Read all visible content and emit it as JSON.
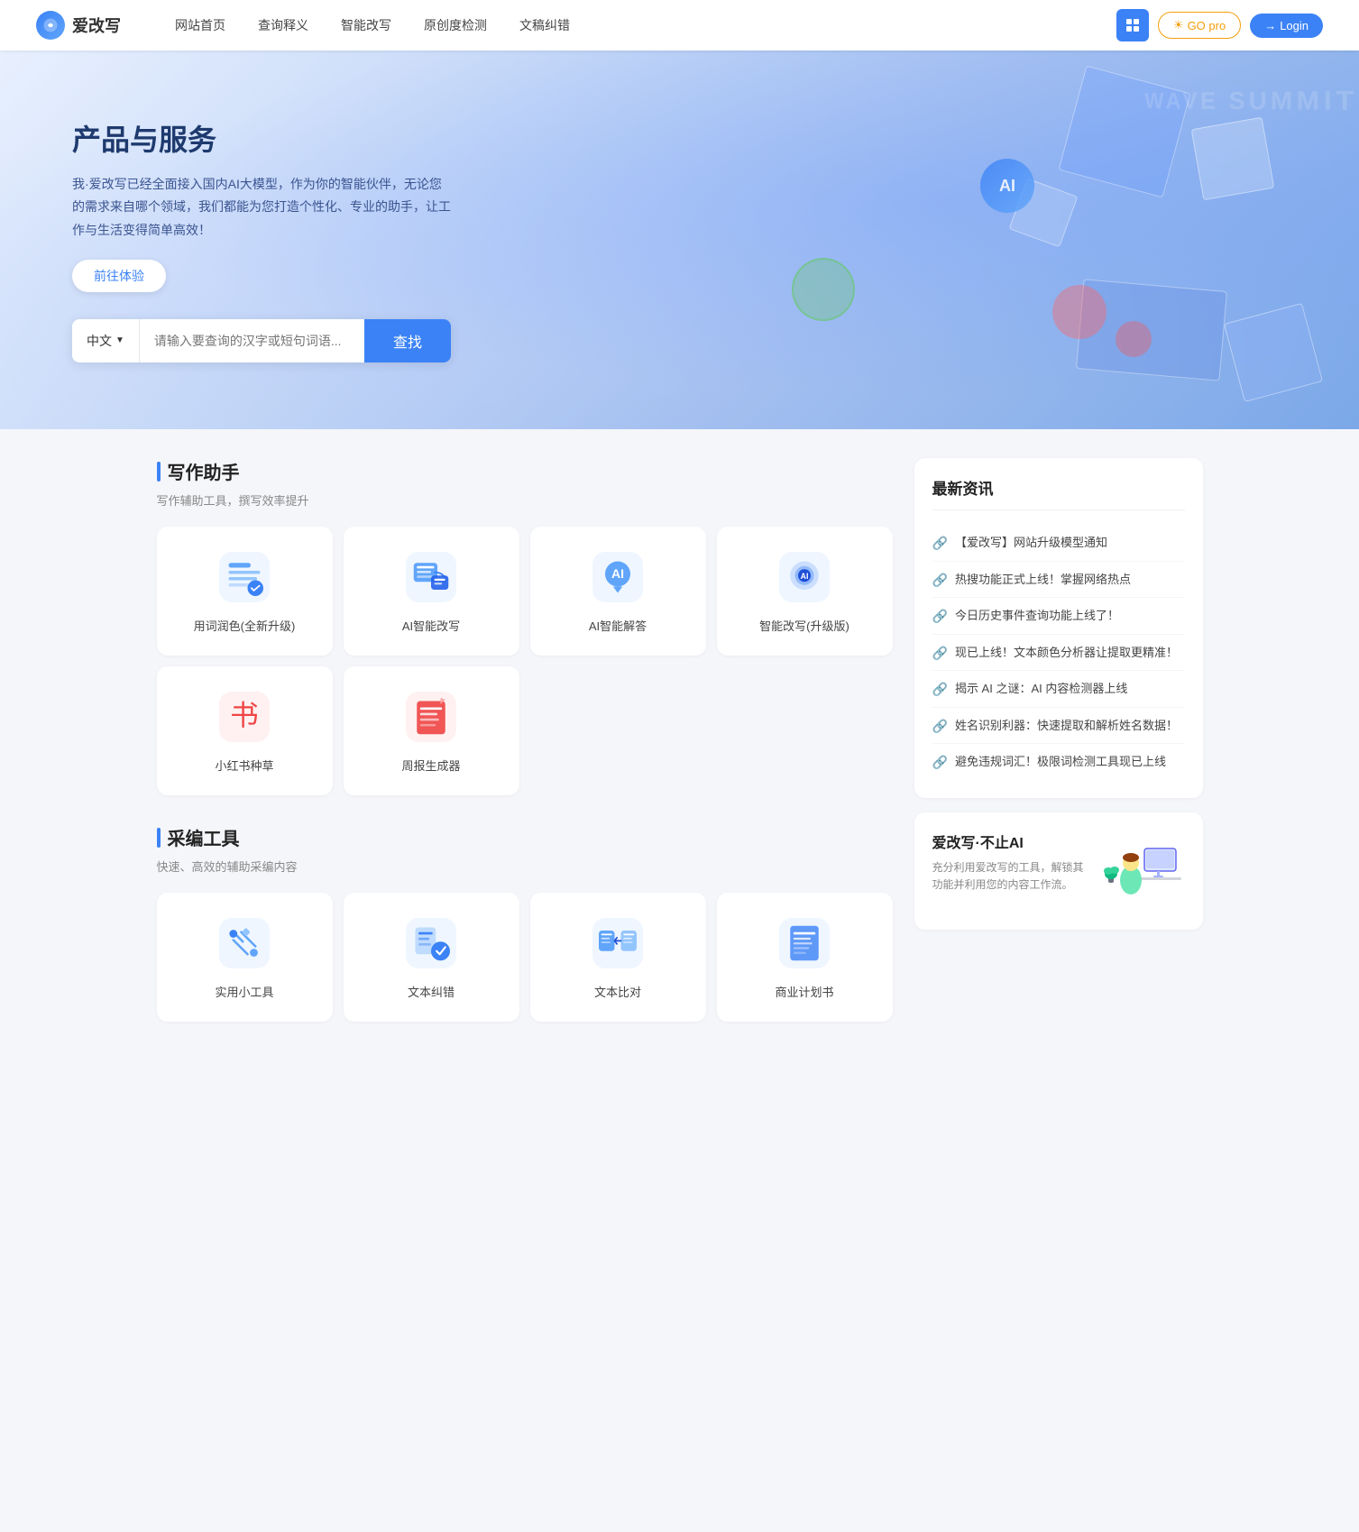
{
  "nav": {
    "logo_text": "爱改写",
    "links": [
      {
        "label": "网站首页",
        "id": "home"
      },
      {
        "label": "查询释义",
        "id": "query"
      },
      {
        "label": "智能改写",
        "id": "rewrite"
      },
      {
        "label": "原创度检测",
        "id": "originality"
      },
      {
        "label": "文稿纠错",
        "id": "proofread"
      }
    ],
    "btn_grid_label": "⊞",
    "btn_go_pro": "GO pro",
    "btn_login": "Login",
    "sun_icon": "☀"
  },
  "hero": {
    "title": "产品与服务",
    "subtitle": "我·爱改写已经全面接入国内AI大模型，作为你的智能伙伴，无论您的需求来自哪个领域，我们都能为您打造个性化、专业的助手，让工作与生活变得简单高效！",
    "btn_try": "前往体验",
    "lang_select": "中文",
    "search_placeholder": "请输入要查询的汉字或短句词语...",
    "btn_search": "查找"
  },
  "writing_section": {
    "title": "写作助手",
    "subtitle": "写作辅助工具，撰写效率提升",
    "cards": [
      {
        "id": "word-color",
        "label": "用词润色(全新升级)"
      },
      {
        "id": "ai-smart-rewrite",
        "label": "AI智能改写"
      },
      {
        "id": "ai-smart-answer",
        "label": "AI智能解答"
      },
      {
        "id": "smart-rewrite-pro",
        "label": "智能改写(升级版)"
      },
      {
        "id": "xiaohongshu",
        "label": "小红书种草"
      },
      {
        "id": "weekly-report",
        "label": "周报生成器"
      }
    ]
  },
  "tools_section": {
    "title": "采编工具",
    "subtitle": "快速、高效的辅助采编内容",
    "cards": [
      {
        "id": "utility-tools",
        "label": "实用小工具"
      },
      {
        "id": "text-proofread",
        "label": "文本纠错"
      },
      {
        "id": "text-compare",
        "label": "文本比对"
      },
      {
        "id": "business-plan",
        "label": "商业计划书"
      }
    ]
  },
  "news": {
    "title": "最新资讯",
    "items": [
      {
        "text": "【爱改写】网站升级模型通知"
      },
      {
        "text": "热搜功能正式上线！掌握网络热点"
      },
      {
        "text": "今日历史事件查询功能上线了！"
      },
      {
        "text": "现已上线！文本颜色分析器让提取更精准！"
      },
      {
        "text": "揭示 AI 之谜：AI 内容检测器上线"
      },
      {
        "text": "姓名识别利器：快速提取和解析姓名数据！"
      },
      {
        "text": "避免违规词汇！极限词检测工具现已上线"
      }
    ]
  },
  "promo": {
    "title": "爱改写·不止AI",
    "text": "充分利用爱改写的工具，解锁其功能并利用您的内容工作流。"
  }
}
